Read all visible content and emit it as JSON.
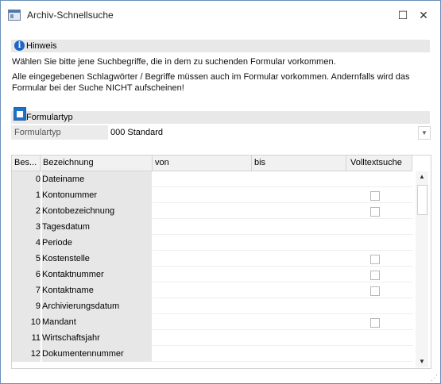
{
  "window": {
    "title": "Archiv-Schnellsuche",
    "minimize": "☐",
    "close": "✕"
  },
  "hint": {
    "title": "Hinweis",
    "line1": "Wählen Sie bitte jene Suchbegriffe, die in dem zu suchenden Formular vorkommen.",
    "line2": "Alle eingegebenen Schlagwörter / Begriffe müssen auch im Formular vorkommen. Andernfalls wird das Formular bei der Suche NICHT aufscheinen!"
  },
  "formulartyp": {
    "section_title": "Formulartyp",
    "label": "Formulartyp",
    "value": "000 Standard"
  },
  "table": {
    "headers": [
      "Bes...",
      "Bezeichnung",
      "von",
      "bis",
      "Volltextsuche"
    ],
    "rows": [
      {
        "num": "0",
        "name": "Dateiname",
        "checkbox": false
      },
      {
        "num": "1",
        "name": "Kontonummer",
        "checkbox": true
      },
      {
        "num": "2",
        "name": "Kontobezeichnung",
        "checkbox": true
      },
      {
        "num": "3",
        "name": "Tagesdatum",
        "checkbox": false
      },
      {
        "num": "4",
        "name": "Periode",
        "checkbox": false
      },
      {
        "num": "5",
        "name": "Kostenstelle",
        "checkbox": true
      },
      {
        "num": "6",
        "name": "Kontaktnummer",
        "checkbox": true
      },
      {
        "num": "7",
        "name": "Kontaktname",
        "checkbox": true
      },
      {
        "num": "9",
        "name": "Archivierungsdatum",
        "checkbox": false
      },
      {
        "num": "10",
        "name": "Mandant",
        "checkbox": true
      },
      {
        "num": "11",
        "name": "Wirtschaftsjahr",
        "checkbox": false
      },
      {
        "num": "12",
        "name": "Dokumentennummer",
        "checkbox": false
      }
    ]
  },
  "icons": {
    "info": "i",
    "dropdown": "▼",
    "up": "▲",
    "down": "▼",
    "grip": "⋰"
  }
}
